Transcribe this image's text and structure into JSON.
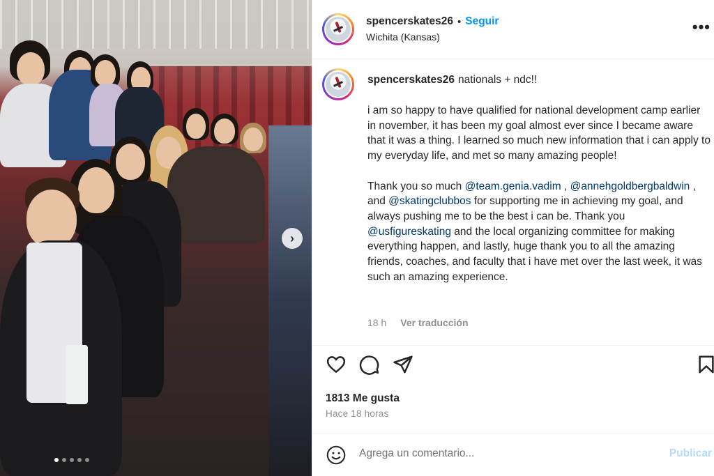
{
  "post": {
    "username": "spencerskates26",
    "separator": "•",
    "follow_label": "Seguir",
    "location": "Wichita (Kansas)",
    "more_label": "•••",
    "caption_title": "nationals + ndc!!",
    "caption_p1": "i am so happy to have qualified for national development camp earlier in november, it has been my goal almost ever since I became aware that it was a thing. I learned so much new information that i can apply to my everyday life, and met so many amazing people!",
    "caption_p2": {
      "t1": "Thank you so much ",
      "m1": "@team.genia.vadim",
      "t2": " , ",
      "m2": "@annehgoldbergbaldwin",
      "t3": " , and ",
      "m3": "@skatingclubbos",
      "t4": " for supporting me in achieving my goal, and always pushing me to be the best i can be. Thank you ",
      "m4": "@usfigureskating",
      "t5": " and the local organizing committee for making everything happen, and lastly, huge thank you to all the amazing friends, coaches, and faculty that i have met over the last week, it was such an amazing experience."
    },
    "time": "18 h",
    "translate_label": "Ver traducción",
    "likes": "1813 Me gusta",
    "ago": "Hace 18 horas",
    "comment_placeholder": "Agrega un comentario...",
    "publish_label": "Publicar"
  },
  "icons": {
    "like": "heart-icon",
    "comment": "comment-icon",
    "share": "paper-plane-icon",
    "save": "bookmark-icon",
    "emoji": "smiley-icon",
    "next": "chevron-right-icon"
  },
  "carousel": {
    "slides": 5,
    "active": 1
  },
  "colors": {
    "link": "#00376b",
    "follow": "#0095f6",
    "muted": "#8e8e8e",
    "publish": "#b3dbff"
  }
}
